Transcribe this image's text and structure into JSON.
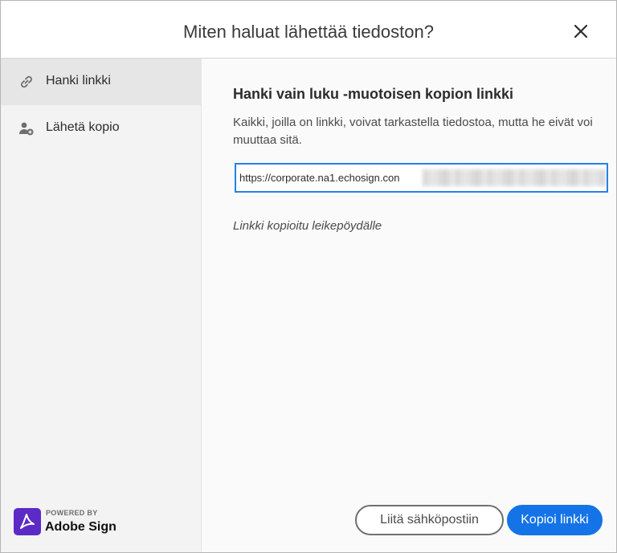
{
  "dialog": {
    "title": "Miten haluat lähettää tiedoston?",
    "close_icon": "close-icon"
  },
  "sidebar": {
    "items": [
      {
        "label": "Hanki linkki",
        "icon": "link-icon",
        "active": true
      },
      {
        "label": "Lähetä kopio",
        "icon": "add-person-icon",
        "active": false
      }
    ]
  },
  "main": {
    "section_title": "Hanki vain luku -muotoisen kopion linkki",
    "description": "Kaikki, joilla on linkki, voivat tarkastella tiedostoa, mutta he eivät voi muuttaa sitä.",
    "link_value": "https://corporate.na1.echosign.con",
    "copied_note": "Linkki kopioitu leikepöydälle"
  },
  "footer": {
    "powered_by": "POWERED BY",
    "brand_name": "Adobe Sign",
    "secondary_button": "Liitä sähköpostiin",
    "primary_button": "Kopioi linkki"
  },
  "colors": {
    "accent": "#1473e6",
    "focus_border": "#2680eb",
    "brand": "#5c2bc5"
  }
}
